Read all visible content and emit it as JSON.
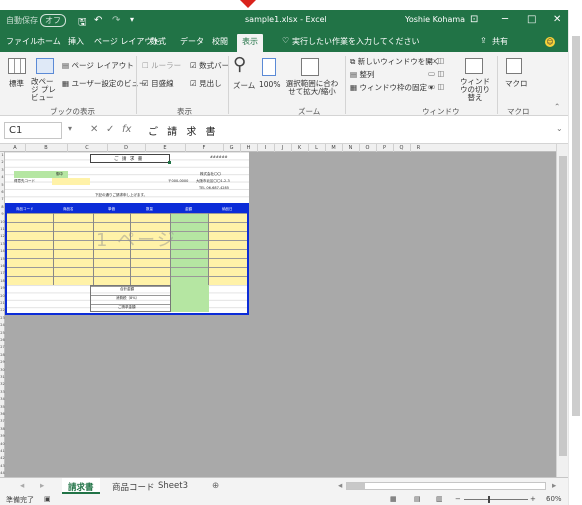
{
  "titlebar": {
    "autosave": "自動保存",
    "autosave_state": "オフ",
    "filename": "sample1.xlsx - Excel",
    "user": "Yoshie Kohama",
    "colors": {
      "brand": "#217346",
      "highlight": "#b5e6a2",
      "yellow": "#fff2a8",
      "blue_header": "#0b2cd8"
    }
  },
  "tabs": [
    "ファイル",
    "ホーム",
    "挿入",
    "ページ レイアウト",
    "数式",
    "データ",
    "校閲",
    "表示"
  ],
  "active_tab": "表示",
  "tell_me": "実行したい作業を入力してください",
  "share": "共有",
  "ribbon": {
    "workbook_views": {
      "normal": "標準",
      "page_break": "改ページ プレビュー",
      "page_layout": "ページ レイアウト",
      "custom_views": "ユーザー設定のビュー",
      "label": "ブックの表示"
    },
    "show": {
      "ruler": "ルーラー",
      "formula_bar": "数式バー",
      "gridlines": "目盛線",
      "headings": "見出し",
      "label": "表示"
    },
    "zoom": {
      "zoom": "ズーム",
      "zoom100": "100%",
      "zoom_selection": "選択範囲に合わせて拡大/縮小",
      "label": "ズーム"
    },
    "window": {
      "new_window": "新しいウィンドウを開く",
      "arrange": "整列",
      "freeze": "ウィンドウ枠の固定",
      "switch": "ウィンドウの切り替え",
      "label": "ウィンドウ"
    },
    "macro": {
      "macro": "マクロ",
      "label": "マクロ"
    }
  },
  "formula_bar": {
    "cell": "C1",
    "value": "ご 請 求 書"
  },
  "columns": [
    "A",
    "B",
    "C",
    "D",
    "E",
    "F",
    "G",
    "H",
    "I",
    "J",
    "K",
    "L",
    "M",
    "N",
    "O",
    "P",
    "Q",
    "R"
  ],
  "rows": [
    "1",
    "2",
    "3",
    "4",
    "5",
    "6",
    "7",
    "8",
    "9",
    "10",
    "11",
    "12",
    "13",
    "14",
    "15",
    "16",
    "17",
    "18",
    "19",
    "20",
    "21",
    "22",
    "23",
    "24",
    "25",
    "26",
    "27",
    "28",
    "29",
    "30",
    "31",
    "32",
    "33",
    "34",
    "35",
    "36",
    "37",
    "38",
    "39",
    "40",
    "41",
    "42",
    "43",
    "44"
  ],
  "sheet": {
    "title": "ご 請 求 書",
    "date_mark": "######",
    "honorific": "御中",
    "company_label": "得意先コード",
    "postal": "〒000-0000",
    "address": "大阪市北区〇〇1-2-3",
    "company": "株式会社〇〇",
    "tel": "TEL 06-687-4285",
    "request_text": "下記の通りご請求申し上げます。",
    "page_watermark": "1 ページ",
    "table_headers": [
      "商品コード",
      "商品名",
      "単価",
      "数量",
      "金額",
      "納品日"
    ],
    "totals": [
      "合計金額",
      "消費税（8%）",
      "ご請求金額"
    ]
  },
  "sheet_tabs": [
    "請求書",
    "商品コード",
    "Sheet3"
  ],
  "active_sheet": "請求書",
  "status": {
    "ready": "準備完了",
    "zoom": "60%"
  }
}
